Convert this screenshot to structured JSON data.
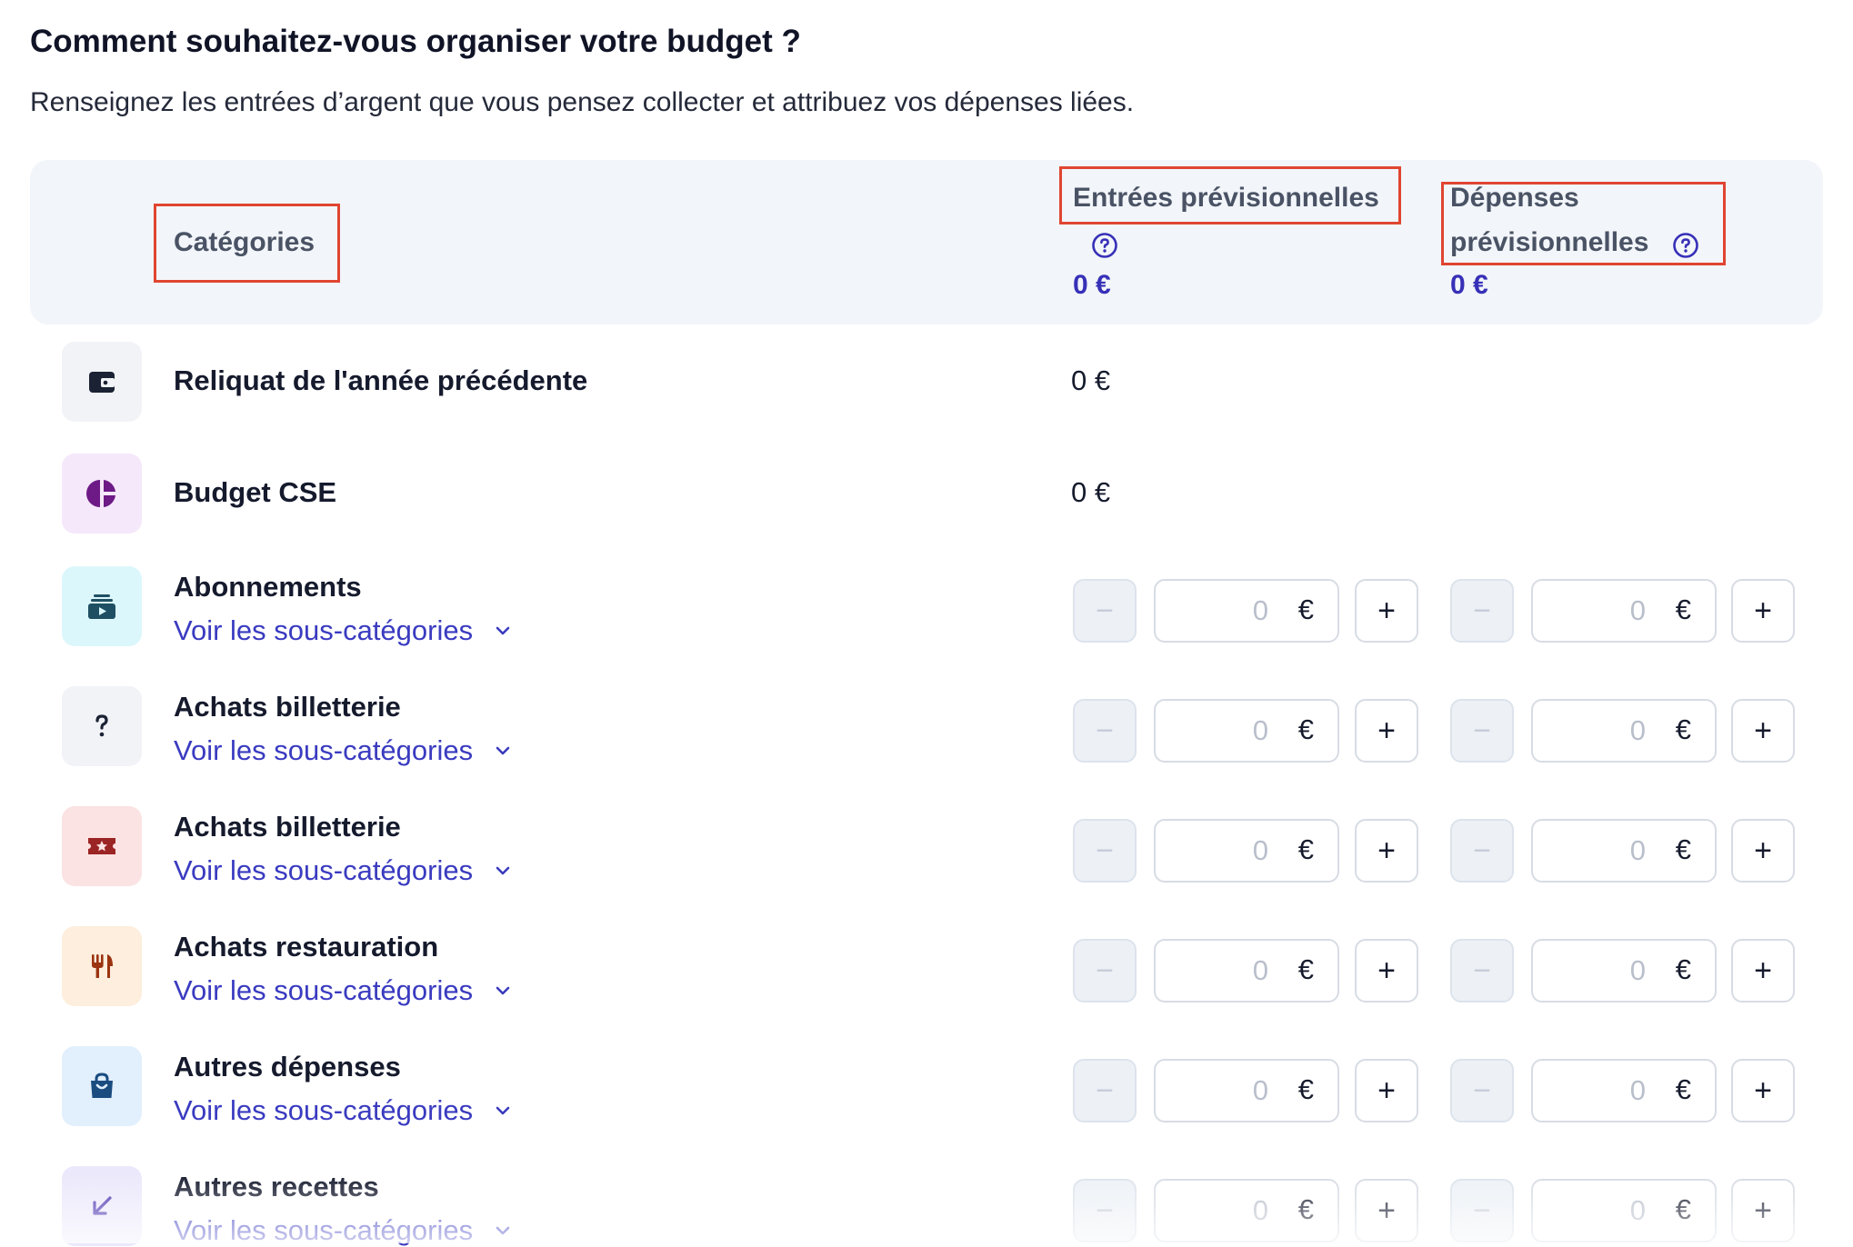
{
  "heading": {
    "title": "Comment souhaitez-vous organiser votre budget ?",
    "subtitle": "Renseignez les entrées d’argent que vous pensez collecter et attribuez vos dépenses liées."
  },
  "table_header": {
    "categories": "Catégories",
    "income_line1": "Entrées prévisionnelles",
    "income_total": "0 €",
    "expense_line1": "Dépenses",
    "expense_line2": "prévisionnelles",
    "expense_total": "0 €"
  },
  "colors": {
    "accent": "#3730b8",
    "highlight_border": "#e04531",
    "header_bg": "#f2f5f9"
  },
  "rows": [
    {
      "label": "Reliquat de l'année précédente",
      "amount": "0 €",
      "icon": "wallet-icon",
      "icon_bg": "#f1f3f7",
      "icon_color": "#1b2233"
    },
    {
      "label": "Budget CSE",
      "amount": "0 €",
      "icon": "pie-chart-icon",
      "icon_bg": "#f5e8fb",
      "icon_color": "#6d1a86"
    },
    {
      "label": "Abonnements",
      "link": "Voir les sous-catégories",
      "icon": "subscription-icon",
      "icon_bg": "#dcf7fb",
      "icon_color": "#1f4f63",
      "income": "0",
      "expense": "0"
    },
    {
      "label": "Achats billetterie",
      "link": "Voir les sous-catégories",
      "icon": "question-mark-icon",
      "icon_bg": "#f1f3f7",
      "icon_color": "#1b2233",
      "income": "0",
      "expense": "0"
    },
    {
      "label": "Achats billetterie",
      "link": "Voir les sous-catégories",
      "icon": "ticket-icon",
      "icon_bg": "#fbe3e3",
      "icon_color": "#9b2424",
      "income": "0",
      "expense": "0"
    },
    {
      "label": "Achats restauration",
      "link": "Voir les sous-catégories",
      "icon": "utensils-icon",
      "icon_bg": "#fdeedd",
      "icon_color": "#9b3410",
      "income": "0",
      "expense": "0"
    },
    {
      "label": "Autres dépenses",
      "link": "Voir les sous-catégories",
      "icon": "shopping-bag-icon",
      "icon_bg": "#e2effc",
      "icon_color": "#1a4c80",
      "income": "0",
      "expense": "0"
    },
    {
      "label": "Autres recettes",
      "link": "Voir les sous-catégories",
      "icon": "arrow-down-left-icon",
      "icon_bg": "#ebe8fb",
      "icon_color": "#4b33b0",
      "income": "0",
      "expense": "0"
    }
  ],
  "stepper": {
    "currency": "€",
    "minus": "−",
    "plus": "+"
  }
}
